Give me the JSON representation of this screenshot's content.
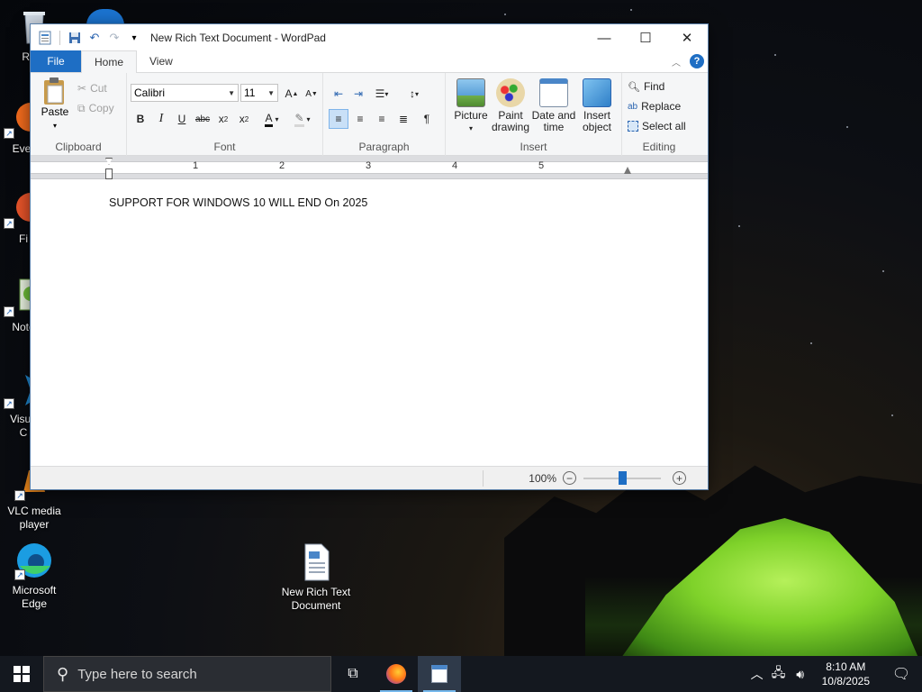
{
  "window": {
    "title": "New Rich Text Document - WordPad"
  },
  "tabs": [
    "File",
    "Home",
    "View"
  ],
  "clipboard": {
    "paste": "Paste",
    "cut": "Cut",
    "copy": "Copy",
    "group_label": "Clipboard"
  },
  "font": {
    "family": "Calibri",
    "size": "11",
    "group_label": "Font"
  },
  "paragraph": {
    "group_label": "Paragraph"
  },
  "insert": {
    "picture": "Picture",
    "paint_drawing_line1": "Paint",
    "paint_drawing_line2": "drawing",
    "date_time_line1": "Date and",
    "date_time_line2": "time",
    "insert_object_line1": "Insert",
    "insert_object_line2": "object",
    "group_label": "Insert"
  },
  "editing": {
    "find": "Find",
    "replace": "Replace",
    "select_all": "Select all",
    "group_label": "Editing"
  },
  "ruler": {
    "numbers": [
      "1",
      "2",
      "3",
      "4",
      "5"
    ]
  },
  "document": {
    "text": "SUPPORT FOR WINDOWS 10 WILL END On 2025"
  },
  "status": {
    "zoom": "100%",
    "zoom_level_fraction": 0.5
  },
  "desktop": {
    "icons": [
      {
        "label": "Recy"
      },
      {
        "label": "Ever"
      },
      {
        "label": "Fi"
      },
      {
        "label": "Note"
      },
      {
        "label_line1": "Visua",
        "label_line2": "C"
      },
      {
        "label_line1": "VLC media",
        "label_line2": "player"
      },
      {
        "label_line1": "Microsoft",
        "label_line2": "Edge"
      },
      {
        "label_line1": "New Rich Text",
        "label_line2": "Document"
      }
    ]
  },
  "taskbar": {
    "search_placeholder": "Type here to search",
    "time": "8:10 AM",
    "date": "10/8/2025"
  },
  "colors": {
    "accent": "#1e6ec4",
    "tent_green": "#8bd63a"
  }
}
